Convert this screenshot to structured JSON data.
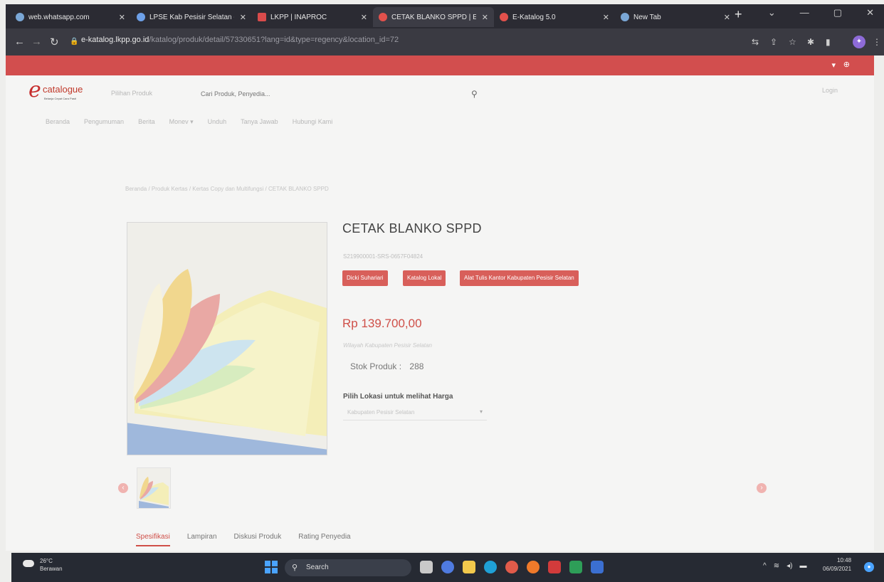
{
  "browser": {
    "tabs": [
      {
        "title": "web.whatsapp.com",
        "color": "#7aa7d6"
      },
      {
        "title": "LPSE Kab Pesisir Selatan - F",
        "color": "#6da0e8"
      },
      {
        "title": "LKPP | INAPROC",
        "color": "#d94b4b"
      },
      {
        "title": "CETAK BLANKO SPPD | E-K",
        "color": "#e2514c"
      },
      {
        "title": "E-Katalog 5.0",
        "color": "#e2514c"
      },
      {
        "title": "New Tab",
        "color": "#7aa7d6"
      }
    ],
    "active_tab_index": 3,
    "url_domain": "e-katalog.lkpp.go.id",
    "url_path": "/katalog/produk/detail/57330651?lang=id&type=regency&location_id=72"
  },
  "site": {
    "logo_text": "catalogue",
    "logo_tagline": "Belanja Cepat Cara Pasti",
    "search_category": "Pilihan Produk",
    "search_placeholder": "Cari Produk, Penyedia...",
    "login_label": "Login",
    "nav": [
      "Beranda",
      "Pengumuman",
      "Berita",
      "Monev ▾",
      "Unduh",
      "Tanya Jawab",
      "Hubungi Kami"
    ]
  },
  "breadcrumb": "Beranda / Produk Kertas / Kertas Copy dan Multifungsi / CETAK BLANKO SPPD",
  "product": {
    "title": "CETAK BLANKO SPPD",
    "sku": "S219900001-SRS-0657F04824",
    "badges": [
      "Dicki Suhariari",
      "Katalog Lokal",
      "Alat Tulis Kantor Kabupaten Pesisir Selatan"
    ],
    "price": "Rp 139.700,00",
    "region": "Wilayah Kabupaten Pesisir Selatan",
    "stock_label": "Stok Produk :",
    "stock_value": "288",
    "location_label": "Pilih Lokasi untuk melihat Harga",
    "location_value": "Kabupaten Pesisir Selatan"
  },
  "detail_tabs": [
    "Spesifikasi",
    "Lampiran",
    "Diskusi Produk",
    "Rating Penyedia"
  ],
  "taskbar": {
    "temperature": "26°C",
    "weather": "Berawan",
    "search_label": "Search",
    "time": "10:48",
    "date": "06/09/2021"
  }
}
